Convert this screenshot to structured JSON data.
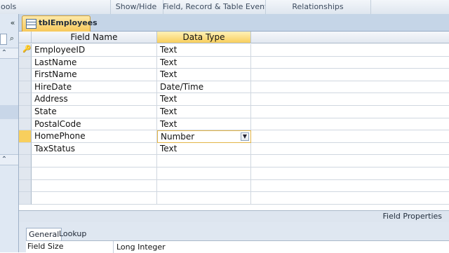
{
  "ribbon": {
    "groups": [
      "ools",
      "Show/Hide",
      "Field, Record & Table Events",
      "Relationships"
    ]
  },
  "nav": {
    "collapse_glyph": "«",
    "search_glyph": "⌕",
    "chevron_up": "⌃"
  },
  "document_tab": {
    "label": "tblEmployees",
    "icon": "table-icon"
  },
  "grid": {
    "columns": [
      "Field Name",
      "Data Type",
      ""
    ],
    "rows": [
      {
        "field": "EmployeeID",
        "type": "Text",
        "key": true
      },
      {
        "field": "LastName",
        "type": "Text"
      },
      {
        "field": "FirstName",
        "type": "Text"
      },
      {
        "field": "HireDate",
        "type": "Date/Time"
      },
      {
        "field": "Address",
        "type": "Text"
      },
      {
        "field": "State",
        "type": "Text"
      },
      {
        "field": "PostalCode",
        "type": "Text"
      },
      {
        "field": "HomePhone",
        "type": "Number",
        "current": true
      },
      {
        "field": "TaxStatus",
        "type": "Text"
      },
      {
        "field": "",
        "type": ""
      },
      {
        "field": "",
        "type": ""
      },
      {
        "field": "",
        "type": ""
      },
      {
        "field": "",
        "type": ""
      }
    ]
  },
  "field_properties": {
    "title": "Field Properties",
    "tabs": [
      "General",
      "Lookup"
    ],
    "active_tab": "General",
    "rows": [
      {
        "name": "Field Size",
        "value": "Long Integer"
      }
    ]
  },
  "colors": {
    "accent": "#f8cf5d",
    "pane": "#dfe8f3"
  }
}
